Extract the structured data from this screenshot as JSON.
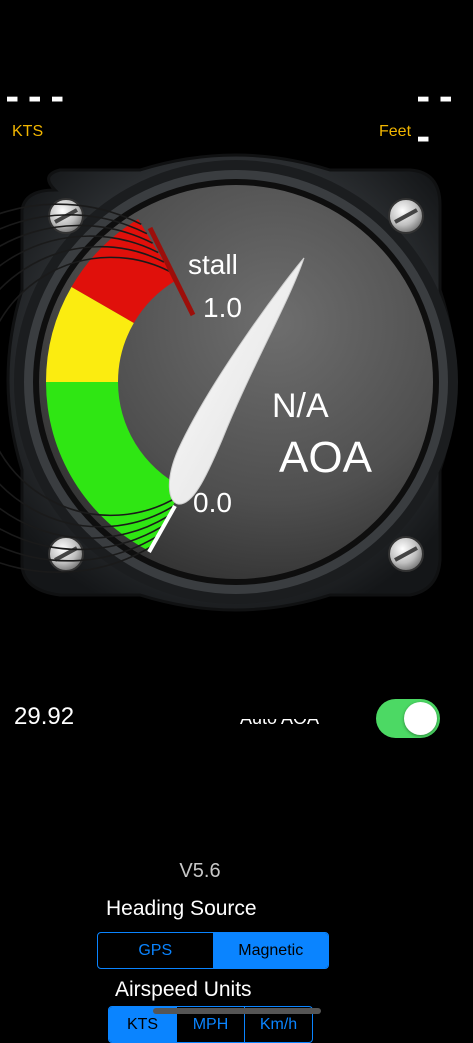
{
  "top_readouts": {
    "left_value": "---",
    "left_unit": "KTS",
    "right_value": "---",
    "right_unit": "Feet"
  },
  "gauge": {
    "stall_label": "stall",
    "max_label": "1.0",
    "min_label": "0.0",
    "value_text": "N/A",
    "title": "AOA",
    "needle_value": 1.0,
    "band_colors": {
      "red": "#e0100b",
      "yellow": "#fbec10",
      "green": "#2fe613"
    }
  },
  "controls": {
    "baro_setting": "29.92",
    "auto_aoa_label": "Auto AOA",
    "auto_aoa_on": true
  },
  "settings": {
    "version": "V5.6",
    "heading_source": {
      "title": "Heading Source",
      "options": [
        "GPS",
        "Magnetic"
      ],
      "selected": "Magnetic"
    },
    "airspeed_units": {
      "title": "Airspeed Units",
      "options": [
        "KTS",
        "MPH",
        "Km/h"
      ],
      "selected": "KTS"
    }
  },
  "colors": {
    "accent": "#0a84ff",
    "unit_label": "#f2b600",
    "toggle_on": "#4cd964"
  }
}
